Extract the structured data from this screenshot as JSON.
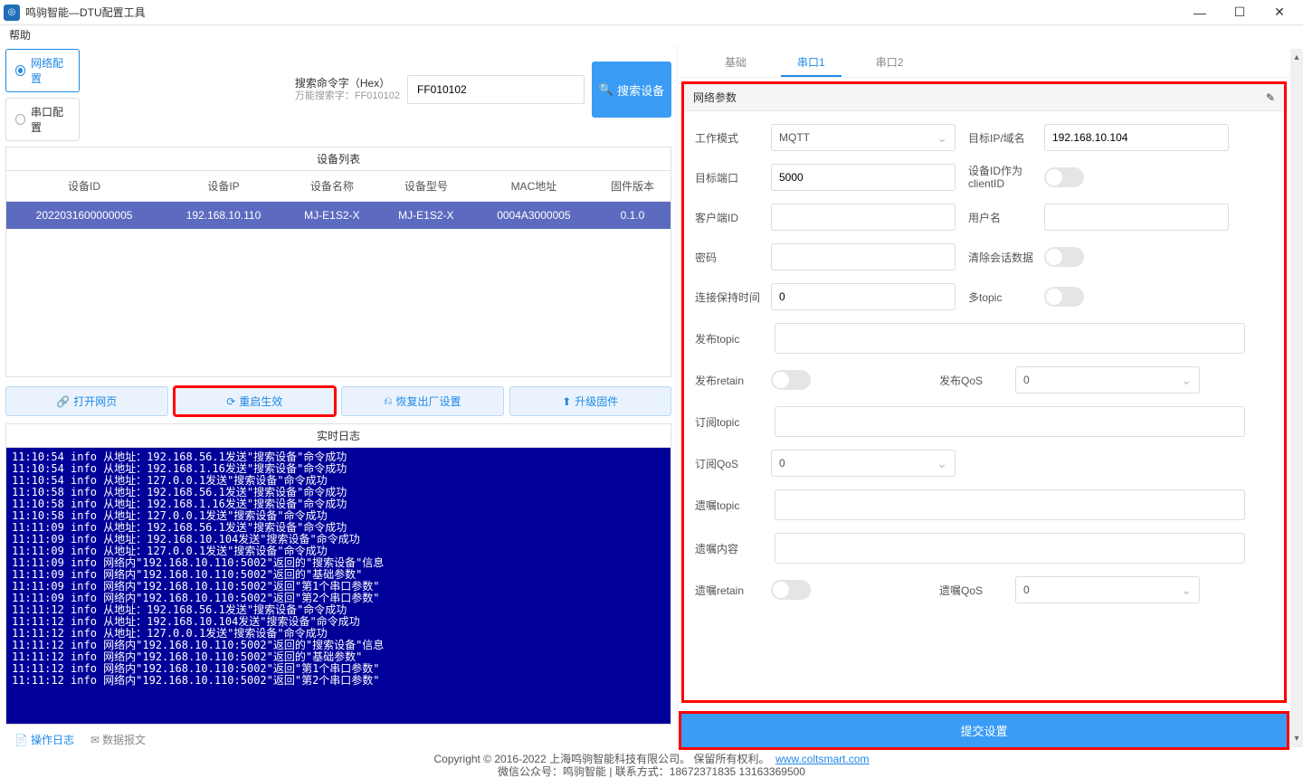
{
  "window": {
    "title": "鸣驹智能—DTU配置工具"
  },
  "menu": {
    "help": "帮助"
  },
  "leftTop": {
    "radio_net": "网络配置",
    "radio_serial": "串口配置",
    "search_label": "搜索命令字（Hex）",
    "search_sub": "万能搜索字：FF010102",
    "search_value": "FF010102",
    "search_btn": "搜索设备"
  },
  "deviceList": {
    "title": "设备列表",
    "cols": [
      "设备ID",
      "设备IP",
      "设备名称",
      "设备型号",
      "MAC地址",
      "固件版本"
    ],
    "rows": [
      [
        "2022031600000005",
        "192.168.10.110",
        "MJ-E1S2-X",
        "MJ-E1S2-X",
        "0004A3000005",
        "0.1.0"
      ]
    ]
  },
  "actions": {
    "open_web": "打开网页",
    "restart": "重启生效",
    "factory": "恢复出厂设置",
    "upgrade": "升级固件"
  },
  "log": {
    "title": "实时日志",
    "lines": [
      "11:10:54 info 从地址：192.168.56.1发送\"搜索设备\"命令成功",
      "11:10:54 info 从地址：192.168.1.16发送\"搜索设备\"命令成功",
      "11:10:54 info 从地址：127.0.0.1发送\"搜索设备\"命令成功",
      "11:10:58 info 从地址：192.168.56.1发送\"搜索设备\"命令成功",
      "11:10:58 info 从地址：192.168.1.16发送\"搜索设备\"命令成功",
      "11:10:58 info 从地址：127.0.0.1发送\"搜索设备\"命令成功",
      "11:11:09 info 从地址：192.168.56.1发送\"搜索设备\"命令成功",
      "11:11:09 info 从地址：192.168.10.104发送\"搜索设备\"命令成功",
      "11:11:09 info 从地址：127.0.0.1发送\"搜索设备\"命令成功",
      "11:11:09 info 网络内\"192.168.10.110:5002\"返回的\"搜索设备\"信息",
      "11:11:09 info 网络内\"192.168.10.110:5002\"返回的\"基础参数\"",
      "11:11:09 info 网络内\"192.168.10.110:5002\"返回\"第1个串口参数\"",
      "11:11:09 info 网络内\"192.168.10.110:5002\"返回\"第2个串口参数\"",
      "11:11:12 info 从地址：192.168.56.1发送\"搜索设备\"命令成功",
      "11:11:12 info 从地址：192.168.10.104发送\"搜索设备\"命令成功",
      "11:11:12 info 从地址：127.0.0.1发送\"搜索设备\"命令成功",
      "11:11:12 info 网络内\"192.168.10.110:5002\"返回的\"搜索设备\"信息",
      "11:11:12 info 网络内\"192.168.10.110:5002\"返回的\"基础参数\"",
      "11:11:12 info 网络内\"192.168.10.110:5002\"返回\"第1个串口参数\"",
      "11:11:12 info 网络内\"192.168.10.110:5002\"返回\"第2个串口参数\""
    ],
    "tabs": {
      "ops": "操作日志",
      "raw": "数据报文"
    }
  },
  "rightTabs": {
    "basic": "基础",
    "s1": "串口1",
    "s2": "串口2"
  },
  "panel": {
    "title": "网络参数",
    "work_mode_l": "工作模式",
    "work_mode_v": "MQTT",
    "target_ip_l": "目标IP/域名",
    "target_ip_v": "192.168.10.104",
    "target_port_l": "目标端口",
    "target_port_v": "5000",
    "devid_client_l": "设备ID作为clientID",
    "client_id_l": "客户端ID",
    "username_l": "用户名",
    "password_l": "密码",
    "clear_sess_l": "清除会话数据",
    "keepalive_l": "连接保持时间",
    "keepalive_v": "0",
    "multi_topic_l": "多topic",
    "pub_topic_l": "发布topic",
    "pub_retain_l": "发布retain",
    "pub_qos_l": "发布QoS",
    "pub_qos_v": "0",
    "sub_topic_l": "订阅topic",
    "sub_qos_l": "订阅QoS",
    "sub_qos_v": "0",
    "will_topic_l": "遗嘱topic",
    "will_content_l": "遗嘱内容",
    "will_retain_l": "遗嘱retain",
    "will_qos_l": "遗嘱QoS",
    "will_qos_v": "0"
  },
  "submit": "提交设置",
  "footer": {
    "line1a": "Copyright © 2016-2022 上海鸣驹智能科技有限公司。 保留所有权利。",
    "line1b": "www.coltsmart.com",
    "line2": "微信公众号：鸣驹智能 | 联系方式：18672371835 13163369500"
  }
}
